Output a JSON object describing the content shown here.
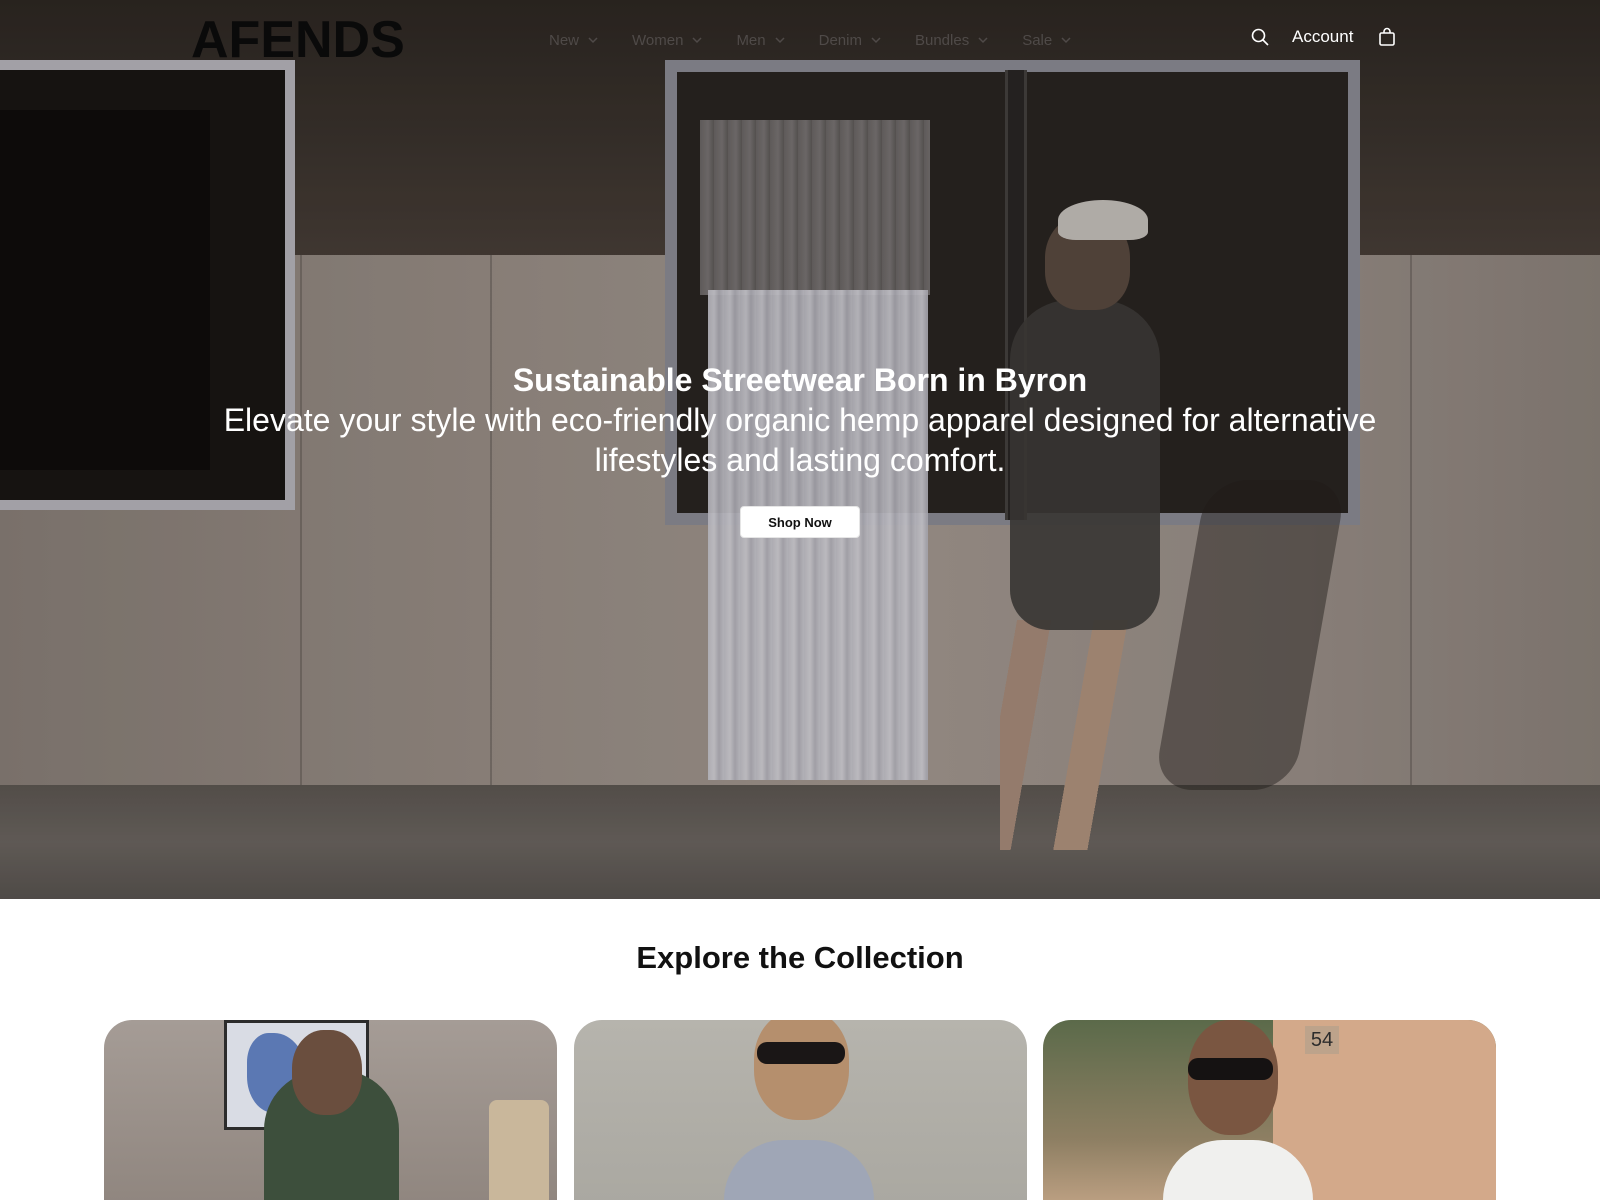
{
  "header": {
    "logo": "AFENDS",
    "nav": [
      {
        "label": "New"
      },
      {
        "label": "Women"
      },
      {
        "label": "Men"
      },
      {
        "label": "Denim"
      },
      {
        "label": "Bundles"
      },
      {
        "label": "Sale"
      }
    ],
    "account_label": "Account",
    "icons": {
      "search": "search-icon",
      "cart": "shopping-bag-icon",
      "chevron": "chevron-down-icon"
    }
  },
  "hero": {
    "title": "Sustainable Streetwear Born in Byron",
    "subtitle": "Elevate your style with eco-friendly organic hemp apparel designed for alternative lifestyles and lasting comfort.",
    "cta_label": "Shop Now"
  },
  "collection": {
    "title": "Explore the Collection",
    "cards": [
      {
        "image": "woman in green plaid top"
      },
      {
        "image": "woman in striped dress with sunglasses"
      },
      {
        "image": "woman in white top with sunglasses",
        "sign_text": "54"
      }
    ]
  },
  "colors": {
    "nav_text": "#4f4a48",
    "hero_text": "#ffffff",
    "logo": "#0a0a0a",
    "button_bg": "#ffffff"
  }
}
